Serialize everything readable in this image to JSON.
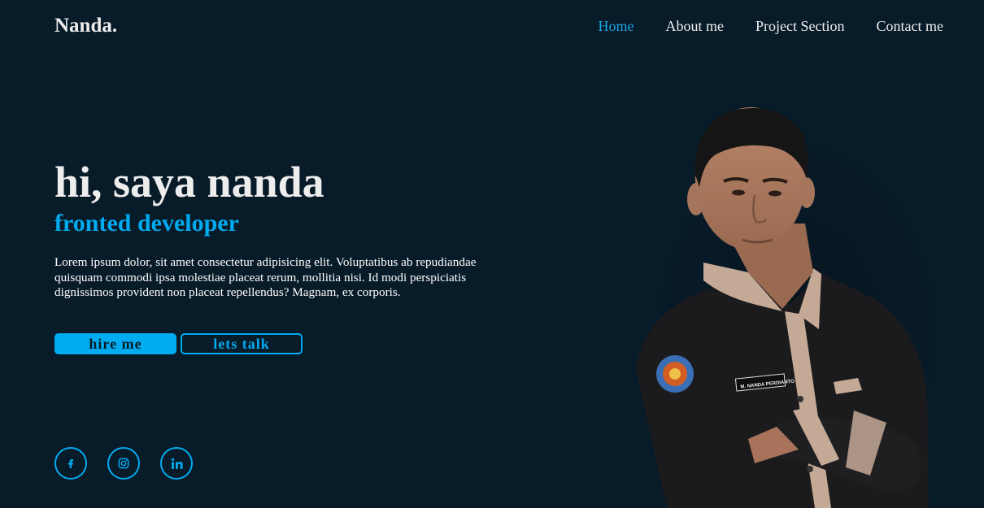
{
  "header": {
    "logo": "Nanda.",
    "nav": [
      {
        "label": "Home",
        "active": true
      },
      {
        "label": "About me",
        "active": false
      },
      {
        "label": "Project Section",
        "active": false
      },
      {
        "label": "Contact me",
        "active": false
      }
    ]
  },
  "hero": {
    "title": "hi, saya nanda",
    "subtitle": "fronted developer",
    "description": "Lorem ipsum dolor, sit amet consectetur adipisicing elit. Voluptatibus ab repudiandae quisquam commodi ipsa molestiae placeat rerum, mollitia nisi. Id modi perspiciatis dignissimos provident non placeat repellendus? Magnam, ex corporis.",
    "buttons": {
      "primary": "hire me",
      "secondary": "lets talk"
    }
  },
  "social": [
    {
      "icon": "facebook-icon"
    },
    {
      "icon": "instagram-icon"
    },
    {
      "icon": "linkedin-icon"
    }
  ],
  "portrait": {
    "badge_text": "M. NANDA PERDIANTO"
  },
  "colors": {
    "background": "#081b29",
    "accent": "#00abf0",
    "text": "#ededed"
  }
}
